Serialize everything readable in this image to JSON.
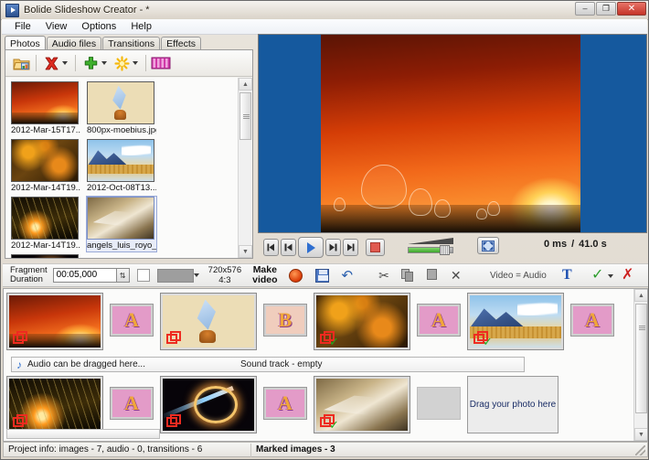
{
  "window": {
    "title": "Bolide Slideshow Creator - *",
    "app_icon": "play-app-icon",
    "minimize": "–",
    "maximize": "❐",
    "close": "✕"
  },
  "menu": {
    "items": [
      "File",
      "View",
      "Options",
      "Help"
    ]
  },
  "tabs": {
    "items": [
      {
        "label": "Photos",
        "active": true
      },
      {
        "label": "Audio files",
        "active": false
      },
      {
        "label": "Transitions",
        "active": false
      },
      {
        "label": "Effects",
        "active": false
      }
    ]
  },
  "library_toolbar": {
    "open_folder": "open-folder-icon",
    "delete": "red-x-icon",
    "add": "green-plus-icon",
    "effects": "yellow-star-icon",
    "film": "pink-film-icon",
    "dropdown": "▾"
  },
  "library": {
    "thumbnails": [
      {
        "caption": "2012-Mar-15T17....",
        "art": "im-sunset",
        "selected": false
      },
      {
        "caption": "800px-moebius.jpg",
        "art": "im-moeb",
        "selected": false
      },
      {
        "caption": "2012-Mar-14T19....",
        "art": "im-autumn",
        "selected": false
      },
      {
        "caption": "2012-Oct-08T13....",
        "art": "im-lake",
        "selected": false
      },
      {
        "caption": "2012-Mar-14T19....",
        "art": "im-grass",
        "selected": false
      },
      {
        "caption": "angels_luis_royo_...",
        "art": "im-angel",
        "selected": true
      },
      {
        "caption": "",
        "art": "im-space",
        "selected": false
      }
    ]
  },
  "player": {
    "skip_start": "skip-to-start",
    "prev": "previous-frame",
    "play": "play",
    "next": "next-frame",
    "skip_end": "skip-to-end",
    "stop": "stop",
    "volume_label": "volume-slider",
    "volume_percent": 68,
    "fullscreen": "fullscreen-icon",
    "time_current": "0 ms",
    "time_separator": "/",
    "time_total": "41.0 s"
  },
  "edit_toolbar": {
    "fragment_label_line1": "Fragment",
    "fragment_label_line2": "Duration",
    "fragment_value": "00:05,000",
    "spinner": "⇅",
    "checkbox_checked": false,
    "color_swatch": "#9e9e9e",
    "color_dropdown": "▾",
    "resolution": "720x576",
    "aspect": "4:3",
    "make_video_line1": "Make",
    "make_video_line2": "video",
    "record": "record-icon",
    "save": "save-icon",
    "undo": "↶",
    "cut": "✂",
    "copy": "copy-icon",
    "paste": "paste-icon",
    "delete": "✕",
    "video_audio": "Video = Audio",
    "text_tool": "T",
    "apply": "✓",
    "apply_dropdown": "▾",
    "cancel": "✗"
  },
  "timeline": {
    "row1": [
      {
        "kind": "slide",
        "art": "im-sunset",
        "marked": true,
        "checked": false
      },
      {
        "kind": "transition",
        "letter": "A",
        "pale": false
      },
      {
        "kind": "slide",
        "art": "im-moeb",
        "marked": true,
        "checked": false
      },
      {
        "kind": "transition",
        "letter": "B",
        "pale": true
      },
      {
        "kind": "slide",
        "art": "im-autumn",
        "marked": true,
        "checked": true
      },
      {
        "kind": "transition",
        "letter": "A",
        "pale": false
      },
      {
        "kind": "slide",
        "art": "im-lake",
        "marked": true,
        "checked": true
      },
      {
        "kind": "transition",
        "letter": "A",
        "pale": false
      }
    ],
    "row2": [
      {
        "kind": "slide",
        "art": "im-grass",
        "marked": true,
        "checked": false
      },
      {
        "kind": "transition",
        "letter": "A",
        "pale": false
      },
      {
        "kind": "slide",
        "art": "im-space",
        "marked": true,
        "checked": false
      },
      {
        "kind": "transition",
        "letter": "A",
        "pale": false
      },
      {
        "kind": "slide",
        "art": "im-angel",
        "marked": true,
        "checked": true
      },
      {
        "kind": "placeholder"
      },
      {
        "kind": "dropzone",
        "text": "Drag your photo here"
      }
    ],
    "audio_track": {
      "icon": "music-note-icon",
      "hint": "Audio can be dragged here...",
      "status": "Sound track - empty"
    }
  },
  "status_bar": {
    "project_info": "Project info: images - 7, audio - 0, transitions - 6",
    "marked": "Marked images - 3"
  }
}
